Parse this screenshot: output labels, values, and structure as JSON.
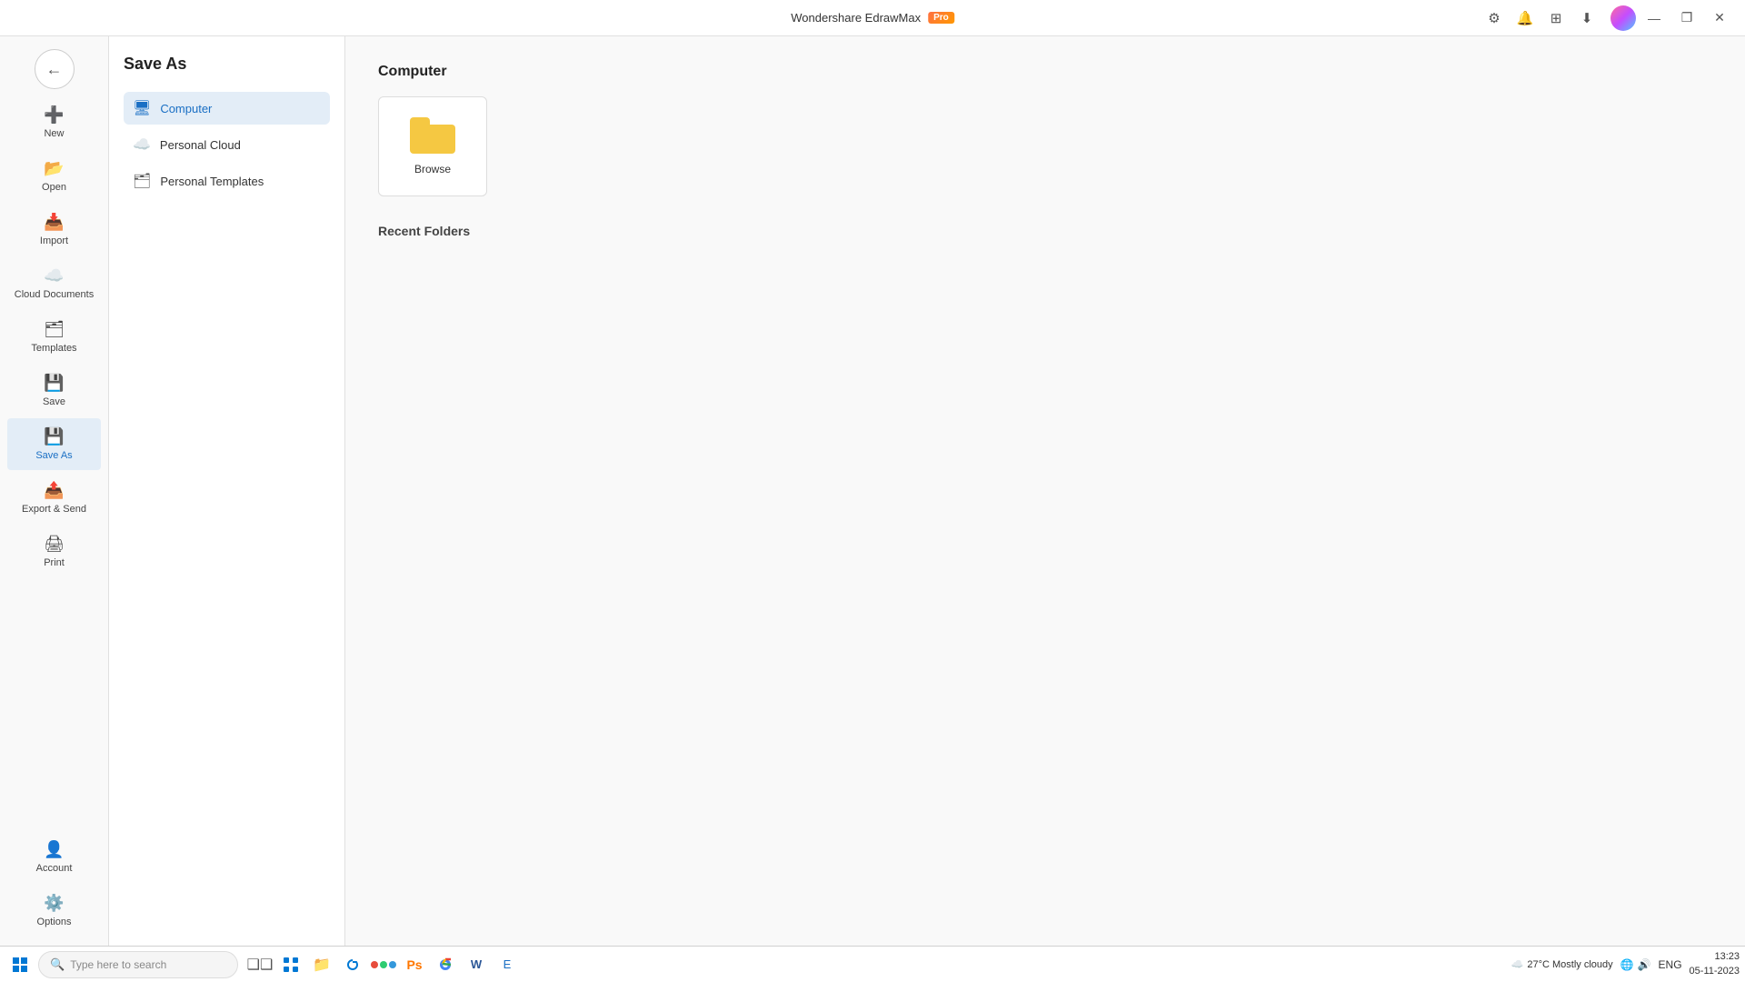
{
  "titleBar": {
    "title": "Wondershare EdrawMax",
    "proBadge": "Pro",
    "windowButtons": {
      "minimize": "—",
      "restore": "❐",
      "close": "✕"
    }
  },
  "sidebar": {
    "items": [
      {
        "id": "new",
        "label": "New",
        "icon": "➕"
      },
      {
        "id": "open",
        "label": "Open",
        "icon": "📂"
      },
      {
        "id": "import",
        "label": "Import",
        "icon": "📥"
      },
      {
        "id": "cloud",
        "label": "Cloud Documents",
        "icon": "☁️"
      },
      {
        "id": "templates",
        "label": "Templates",
        "icon": "🗂"
      },
      {
        "id": "save",
        "label": "Save",
        "icon": "💾"
      },
      {
        "id": "saveas",
        "label": "Save As",
        "icon": "💾",
        "active": true
      },
      {
        "id": "export",
        "label": "Export & Send",
        "icon": "📤"
      },
      {
        "id": "print",
        "label": "Print",
        "icon": "🖨"
      }
    ],
    "bottomItems": [
      {
        "id": "account",
        "label": "Account",
        "icon": "👤"
      },
      {
        "id": "options",
        "label": "Options",
        "icon": "⚙️"
      }
    ]
  },
  "saveAsPanel": {
    "title": "Save As",
    "options": [
      {
        "id": "computer",
        "label": "Computer",
        "icon": "🖥",
        "active": true
      },
      {
        "id": "personalCloud",
        "label": "Personal Cloud",
        "icon": "☁️",
        "active": false
      },
      {
        "id": "personalTemplates",
        "label": "Personal Templates",
        "icon": "🗂",
        "active": false
      }
    ]
  },
  "contentArea": {
    "sectionTitle": "Computer",
    "browseLabel": "Browse",
    "recentFoldersTitle": "Recent Folders"
  },
  "taskbar": {
    "searchPlaceholder": "Type here to search",
    "weather": "27°C  Mostly cloudy",
    "language": "ENG",
    "time": "13:23",
    "date": "05-11-2023",
    "apps": [
      {
        "id": "windows",
        "icon": "⊞",
        "color": "#0078d4"
      },
      {
        "id": "search",
        "icon": "🔍"
      },
      {
        "id": "taskview",
        "icon": "❑"
      },
      {
        "id": "widgets",
        "icon": "▦"
      },
      {
        "id": "edge",
        "icon": "🌐"
      },
      {
        "id": "files",
        "icon": "📁"
      },
      {
        "id": "browser",
        "icon": "🌀"
      },
      {
        "id": "colorDots",
        "icon": ""
      },
      {
        "id": "photoshop",
        "icon": "🔶"
      },
      {
        "id": "chrome",
        "icon": "🔵"
      },
      {
        "id": "word",
        "icon": "📘"
      },
      {
        "id": "edrawmax",
        "icon": "🔷"
      }
    ]
  }
}
